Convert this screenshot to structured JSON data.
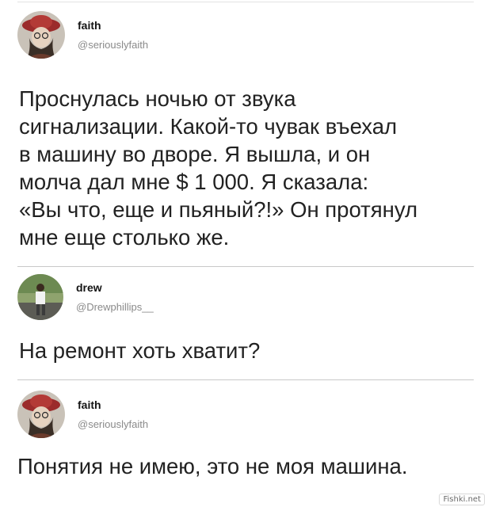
{
  "tweets": [
    {
      "name": "faith",
      "handle": "@seriouslyfaith",
      "text": "Проснулась ночью от звука\nсигнализации. Какой-то чувак въехал\nв машину во дворе. Я вышла, и он\nмолча дал мне $ 1 000. Я сказала:\n«Вы что, еще и пьяный?!» Он протянул\nмне еще столько же."
    },
    {
      "name": "drew",
      "handle": "@Drewphillips__",
      "text": "На ремонт хоть хватит?"
    },
    {
      "name": "faith",
      "handle": "@seriouslyfaith",
      "text": "Понятия не имею, это не моя машина."
    }
  ],
  "watermark": "Fishki.net"
}
